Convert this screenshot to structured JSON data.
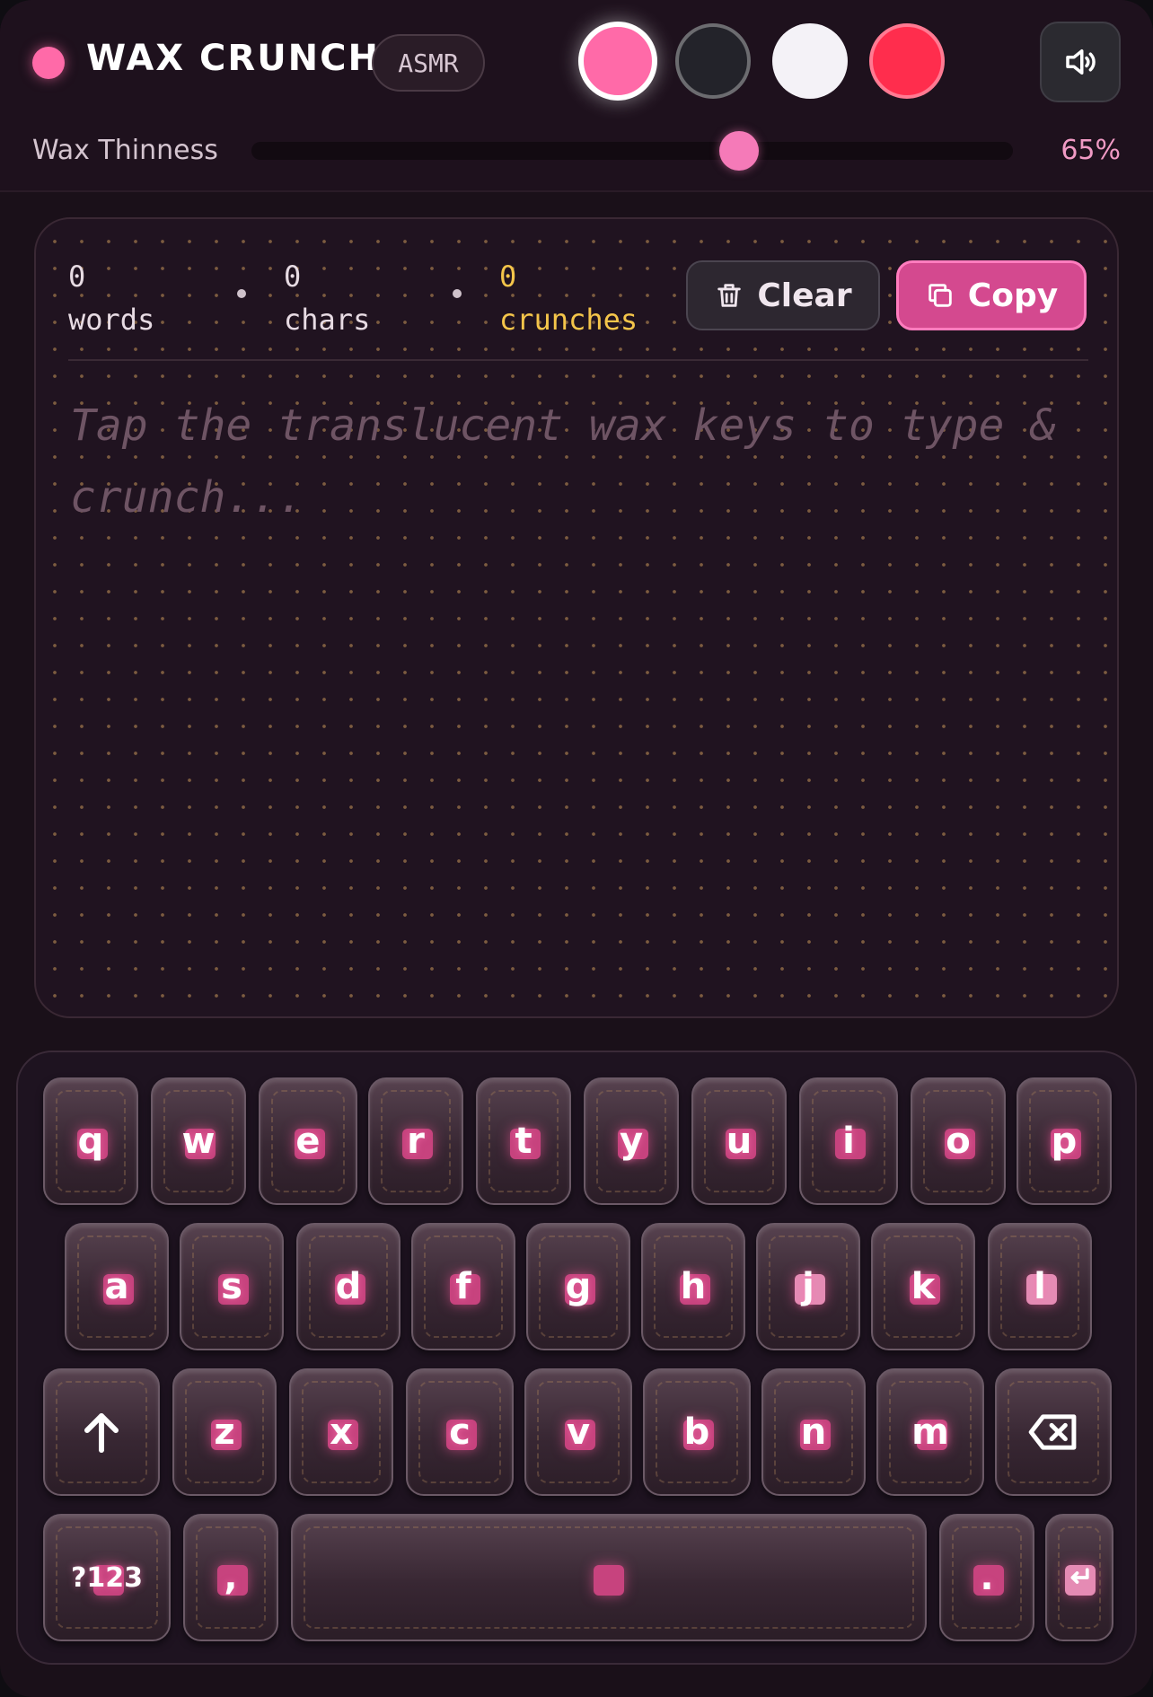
{
  "header": {
    "title": "WAX CRUNCH",
    "badge": "ASMR",
    "swatches": [
      {
        "name": "pink",
        "color": "#ff6aa8",
        "selected": true
      },
      {
        "name": "charcoal",
        "color": "#23232a",
        "selected": false
      },
      {
        "name": "white",
        "color": "#f4f2f7",
        "selected": false
      },
      {
        "name": "red",
        "color": "#ff2d4d",
        "selected": false
      }
    ],
    "sound_icon": "speaker-on-icon"
  },
  "slider": {
    "label": "Wax Thinness",
    "value": 65,
    "value_text": "65%"
  },
  "stats": {
    "words_count": "0",
    "words_label": "words",
    "chars_count": "0",
    "chars_label": "chars",
    "crunches_count": "0",
    "crunches_label": "crunches"
  },
  "actions": {
    "clear_label": "Clear",
    "copy_label": "Copy"
  },
  "editor": {
    "value": "",
    "placeholder": "Tap the translucent wax keys to type & crunch..."
  },
  "keyboard": {
    "row1": [
      "q",
      "w",
      "e",
      "r",
      "t",
      "y",
      "u",
      "i",
      "o",
      "p"
    ],
    "row2": [
      "a",
      "s",
      "d",
      "f",
      "g",
      "h",
      "j",
      "k",
      "l"
    ],
    "row3": [
      "z",
      "x",
      "c",
      "v",
      "b",
      "n",
      "m"
    ],
    "shift_icon": "shift-arrow-icon",
    "backspace_icon": "backspace-icon",
    "symbols_label": "?123",
    "comma_label": ",",
    "period_label": ".",
    "enter_icon": "enter-icon"
  },
  "colors": {
    "accent": "#ff6aa8",
    "copy_button": "#d4498f",
    "crunch_stat": "#f4c54a"
  }
}
